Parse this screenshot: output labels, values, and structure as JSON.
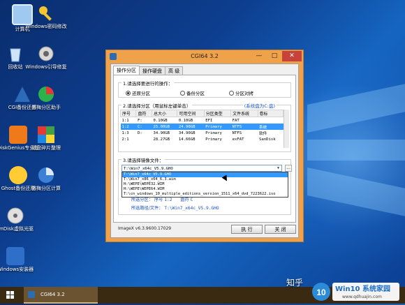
{
  "desktop": {
    "icons": [
      {
        "label": "计算机",
        "icon": "computer-icon"
      },
      {
        "label": "Windows密码修改",
        "icon": "key-icon"
      },
      {
        "label": "回收站",
        "icon": "recycle-bin-icon"
      },
      {
        "label": "Windows引导修复",
        "icon": "gear-icon"
      },
      {
        "label": "CGI备份还原",
        "icon": "cgi-icon"
      },
      {
        "label": "傲梅分区助手",
        "icon": "partition-assistant-icon"
      },
      {
        "label": "DiskGenius专业版",
        "icon": "diskgenius-icon"
      },
      {
        "label": "磁盘碎片整理",
        "icon": "defrag-icon"
      },
      {
        "label": "Ghost备份还原",
        "icon": "ghost-icon"
      },
      {
        "label": "傲梅分区计算",
        "icon": "partition-calc-icon"
      },
      {
        "label": "ImDisk虚拟光驱",
        "icon": "disc-icon"
      },
      {
        "label": "Windows安装器",
        "icon": "installer-icon"
      }
    ]
  },
  "window": {
    "title": "CGI64  3.2",
    "controls": {
      "minimize": "—",
      "maximize": "□",
      "close": "✕"
    },
    "tabs": [
      "操作分区",
      "操作硬盘",
      "高 级"
    ],
    "step1": {
      "title": "1.请选择要进行的操作：",
      "options": [
        "还原分区",
        "备份分区",
        "分区对拷"
      ],
      "selected": "还原分区"
    },
    "step2": {
      "title": "2.请选择分区（用鼠标左键单击）",
      "note": "(系统盘为C:盘)",
      "columns": [
        "序号",
        "盘符",
        "总大小",
        "可用空间",
        "分区类型",
        "文件系统",
        "卷标"
      ],
      "rows": [
        [
          "1:1",
          "F:",
          "0.10GB",
          "0.10GB",
          "EFI",
          "FAT",
          ""
        ],
        [
          "1:2",
          "C:",
          "25.00GB",
          "24.90GB",
          "Primary",
          "NTFS",
          "系统"
        ],
        [
          "1:3",
          "D:",
          "34.90GB",
          "34.90GB",
          "Primary",
          "NTFS",
          "软件"
        ],
        [
          "2:1",
          "",
          "28.27GB",
          "14.66GB",
          "Primary",
          "exFAT",
          "SanDisk"
        ]
      ],
      "selected_row": 1
    },
    "step3": {
      "title": "3.请选择镜像文件：",
      "value": "T:\\Win7_x64c_V5.9.GHO",
      "browse": "...",
      "dropdown": [
        "T:\\Win7_x64c_V5.9.GHO",
        "T:\\Win7_x86_x64_6.3.wim",
        "H:\\WEPE\\WEPE32.WIM",
        "H:\\WEPE\\WEPE64.WIM",
        "T:\\cn_windows_10_multiple_editions_version_1511_x64_dvd_7223622.iso"
      ],
      "highlighted": 0
    },
    "info": {
      "partition_label": "所选分区：",
      "index_label": "序号",
      "index_value": "1:2",
      "drive_label": "盘符",
      "drive_value": "C",
      "path_label": "所选路径/文件：",
      "path_value": "T:\\Win7_x64c_V5.9.GHO"
    },
    "version": "ImageX v6.3.9600.17029",
    "execute_button": "执 行",
    "close_button": "关 闭"
  },
  "taskbar": {
    "task_label": "CGI64  3.2"
  },
  "watermark": {
    "text": "知乎",
    "logo_number": "10",
    "logo_title": "Win10 系统家园",
    "logo_url": "www.qdhuajin.com"
  }
}
